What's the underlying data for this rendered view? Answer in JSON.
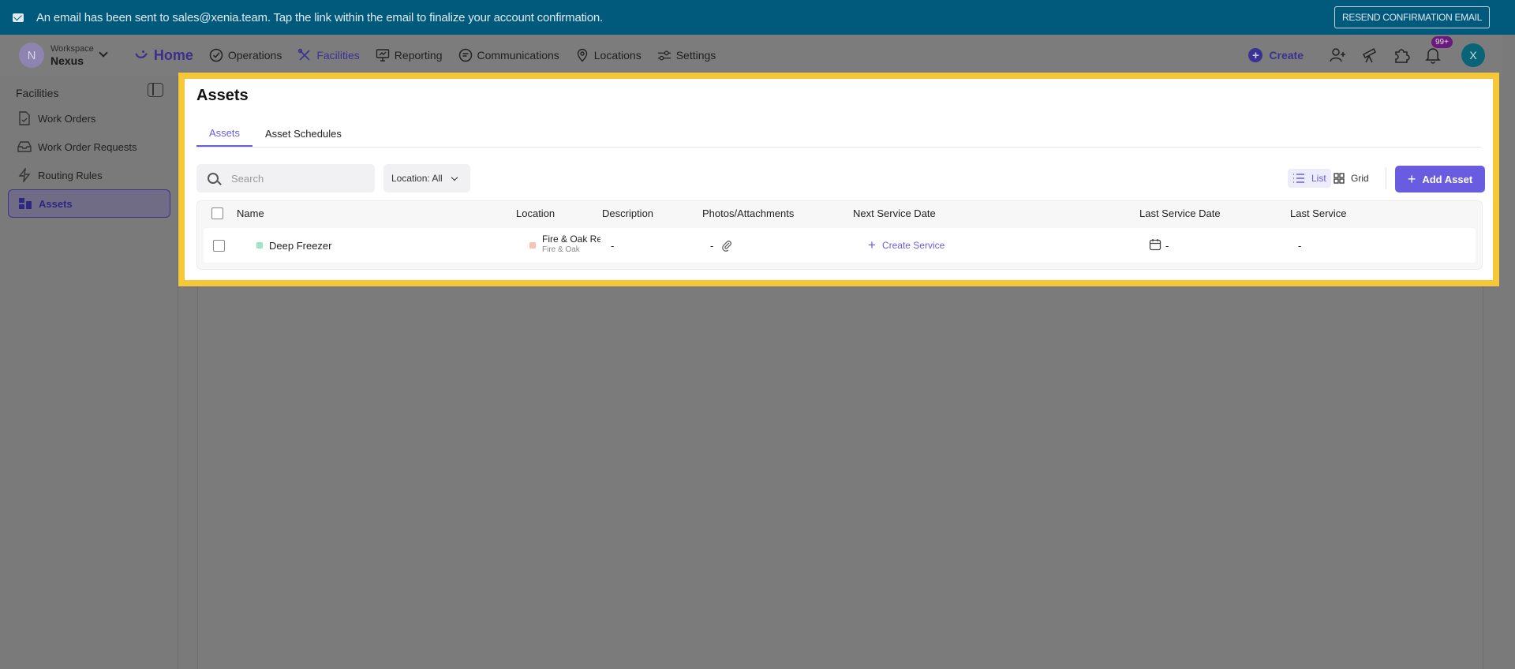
{
  "banner": {
    "message": "An email has been sent to sales@xenia.team. Tap the link within the email to finalize your account confirmation.",
    "resend_label": "RESEND CONFIRMATION EMAIL"
  },
  "workspace": {
    "avatar_letter": "N",
    "caption": "Workspace",
    "name": "Nexus"
  },
  "nav": {
    "home": "Home",
    "operations": "Operations",
    "facilities": "Facilities",
    "reporting": "Reporting",
    "communications": "Communications",
    "locations": "Locations",
    "settings": "Settings",
    "create": "Create",
    "notif_badge": "99+",
    "user_letter": "X"
  },
  "sidebar": {
    "title": "Facilities",
    "items": [
      {
        "label": "Work Orders"
      },
      {
        "label": "Work Order Requests"
      },
      {
        "label": "Routing Rules"
      },
      {
        "label": "Assets"
      }
    ]
  },
  "page": {
    "title": "Assets",
    "tabs": [
      {
        "label": "Assets"
      },
      {
        "label": "Asset Schedules"
      }
    ],
    "search_placeholder": "Search",
    "location_filter": "Location: All",
    "view_list": "List",
    "view_grid": "Grid",
    "add_asset": "Add Asset"
  },
  "table": {
    "headers": {
      "name": "Name",
      "location": "Location",
      "description": "Description",
      "photos": "Photos/Attachments",
      "next_service": "Next Service Date",
      "last_service_date": "Last Service Date",
      "last_service": "Last Service"
    },
    "rows": [
      {
        "name": "Deep Freezer",
        "location_main": "Fire & Oak Re",
        "location_sub": "Fire & Oak",
        "description": "-",
        "photos": "-",
        "create_service": "Create Service",
        "last_service_date": "-",
        "last_service": "-"
      }
    ]
  },
  "colors": {
    "accent": "#6a5ce0",
    "banner": "#015a7c",
    "highlight": "#f5c83a",
    "asset_marker": "#9fe3c9",
    "location_marker": "#f7c4b3"
  }
}
